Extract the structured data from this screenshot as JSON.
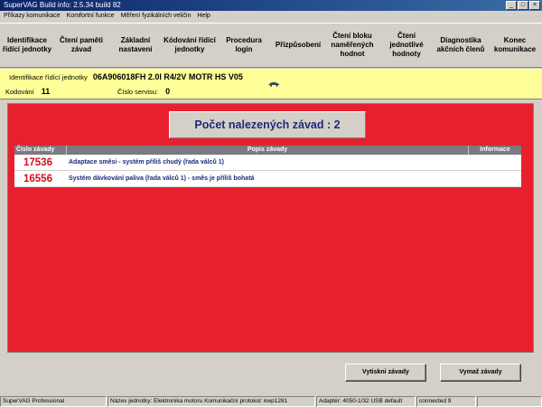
{
  "window": {
    "title": "SuperVAG Build info: 2.5.34 build 82"
  },
  "menu": [
    "Příkazy komunikace",
    "Komfortní funkce",
    "Měření fyzikálních veličin",
    "Help"
  ],
  "toolbar": [
    "Identifikace řídící jednotky",
    "Čtení paměti závad",
    "Základní nastavení",
    "Kódování řídící jednotky",
    "Procedura login",
    "Přizpůsobení",
    "Čtení bloku naměřených hodnot",
    "Čtení jednotlivé hodnoty",
    "Diagnostika akčních členů",
    "Konec komunikace"
  ],
  "info": {
    "id_label": "Identifikace řídící jednotky",
    "id_value": "06A906018FH 2.0l R4/2V   MOTR HS V05",
    "coding_label": "Kodování",
    "coding_value": "11",
    "service_label": "Číslo servisu:",
    "service_value": "0"
  },
  "result": {
    "text": "Počet nalezených závad : 2"
  },
  "faults": {
    "headers": {
      "code": "Číslo závady",
      "description": "Popis závady",
      "info": "Informace"
    },
    "rows": [
      {
        "code": "17536",
        "description": "Adaptace směsi - systém příliš chudý (řada válců 1)"
      },
      {
        "code": "16556",
        "description": "Systém dávkování paliva (řada válců 1) - směs je příliš bohatá"
      }
    ]
  },
  "buttons": {
    "print": "Vytiskni závady",
    "clear": "Vymaž závady"
  },
  "status": {
    "app": "SuperVAG Professional",
    "unit": "Název jednotky: Elektronika motoru",
    "protocol": "Komunikační protokol:  kwp1281",
    "adapter": "Adaptér: 4050-1/32 USB default",
    "connection": "connected 9"
  },
  "colors": {
    "panel_red": "#e8202e",
    "info_yellow": "#ffff99",
    "text_navy": "#1a2a7a",
    "code_red": "#d0101a"
  }
}
